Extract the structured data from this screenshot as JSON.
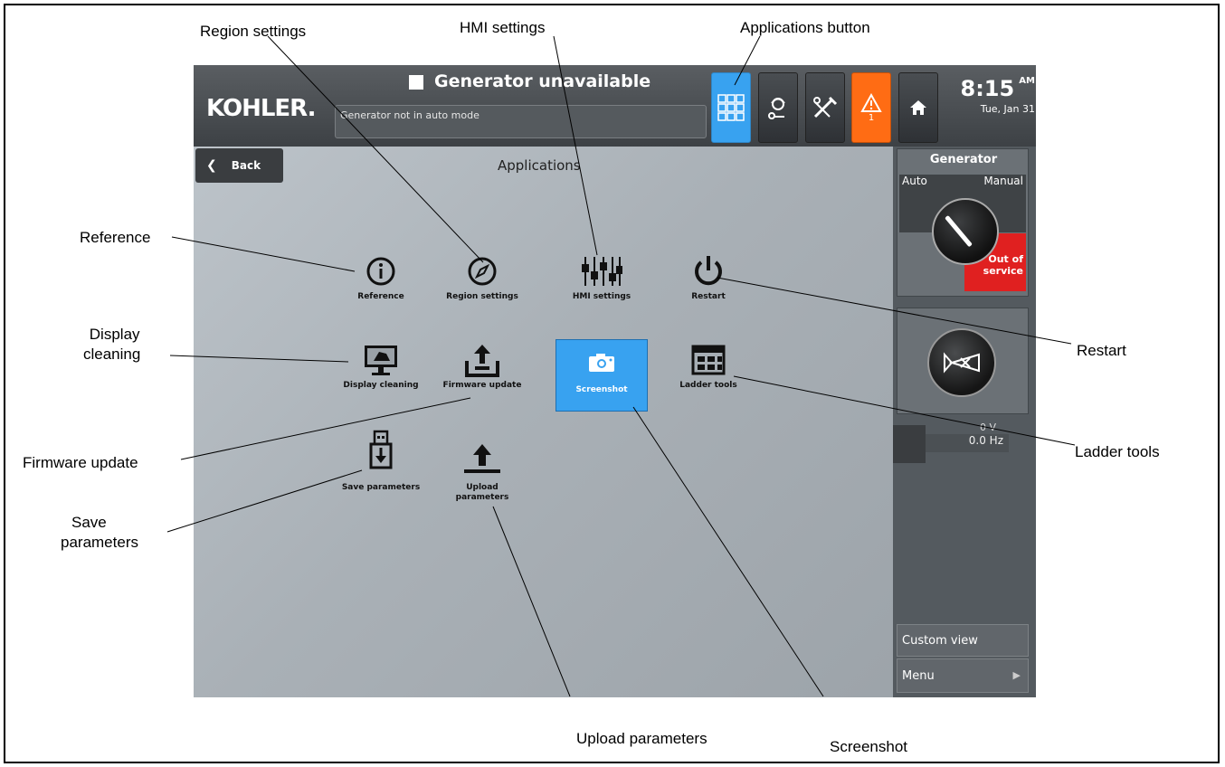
{
  "callouts": {
    "region_settings": "Region settings",
    "hmi_settings": "HMI settings",
    "applications_button": "Applications button",
    "reference": "Reference",
    "display_cleaning_1": "Display",
    "display_cleaning_2": "cleaning",
    "restart": "Restart",
    "firmware_update": "Firmware update",
    "ladder_tools": "Ladder tools",
    "save_parameters_1": "Save",
    "save_parameters_2": "parameters",
    "upload_parameters": "Upload parameters",
    "screenshot": "Screenshot"
  },
  "hmi": {
    "logo": "KOHLER.",
    "status_title": "Generator unavailable",
    "status_message": "Generator not in auto mode",
    "alarm_count": "1",
    "time": "8:15",
    "ampm": "AM",
    "date": "Tue, Jan 31",
    "back_label": "Back",
    "page_title": "Applications",
    "apps": {
      "reference": "Reference",
      "region_settings": "Region settings",
      "hmi_settings": "HMI settings",
      "restart": "Restart",
      "display_cleaning": "Display cleaning",
      "firmware_update": "Firmware update",
      "screenshot": "Screenshot",
      "ladder_tools": "Ladder tools",
      "save_parameters": "Save parameters",
      "upload_parameters": "Upload parameters"
    },
    "generator_panel": {
      "title": "Generator",
      "auto": "Auto",
      "manual": "Manual",
      "out_of_service": "Out of service",
      "voltage": "0 V",
      "frequency": "0.0 Hz"
    },
    "custom_view": "Custom view",
    "menu": "Menu"
  },
  "colors": {
    "accent_blue": "#38a2f0",
    "alarm_orange": "#ff6c14",
    "out_of_service_red": "#e02020"
  }
}
